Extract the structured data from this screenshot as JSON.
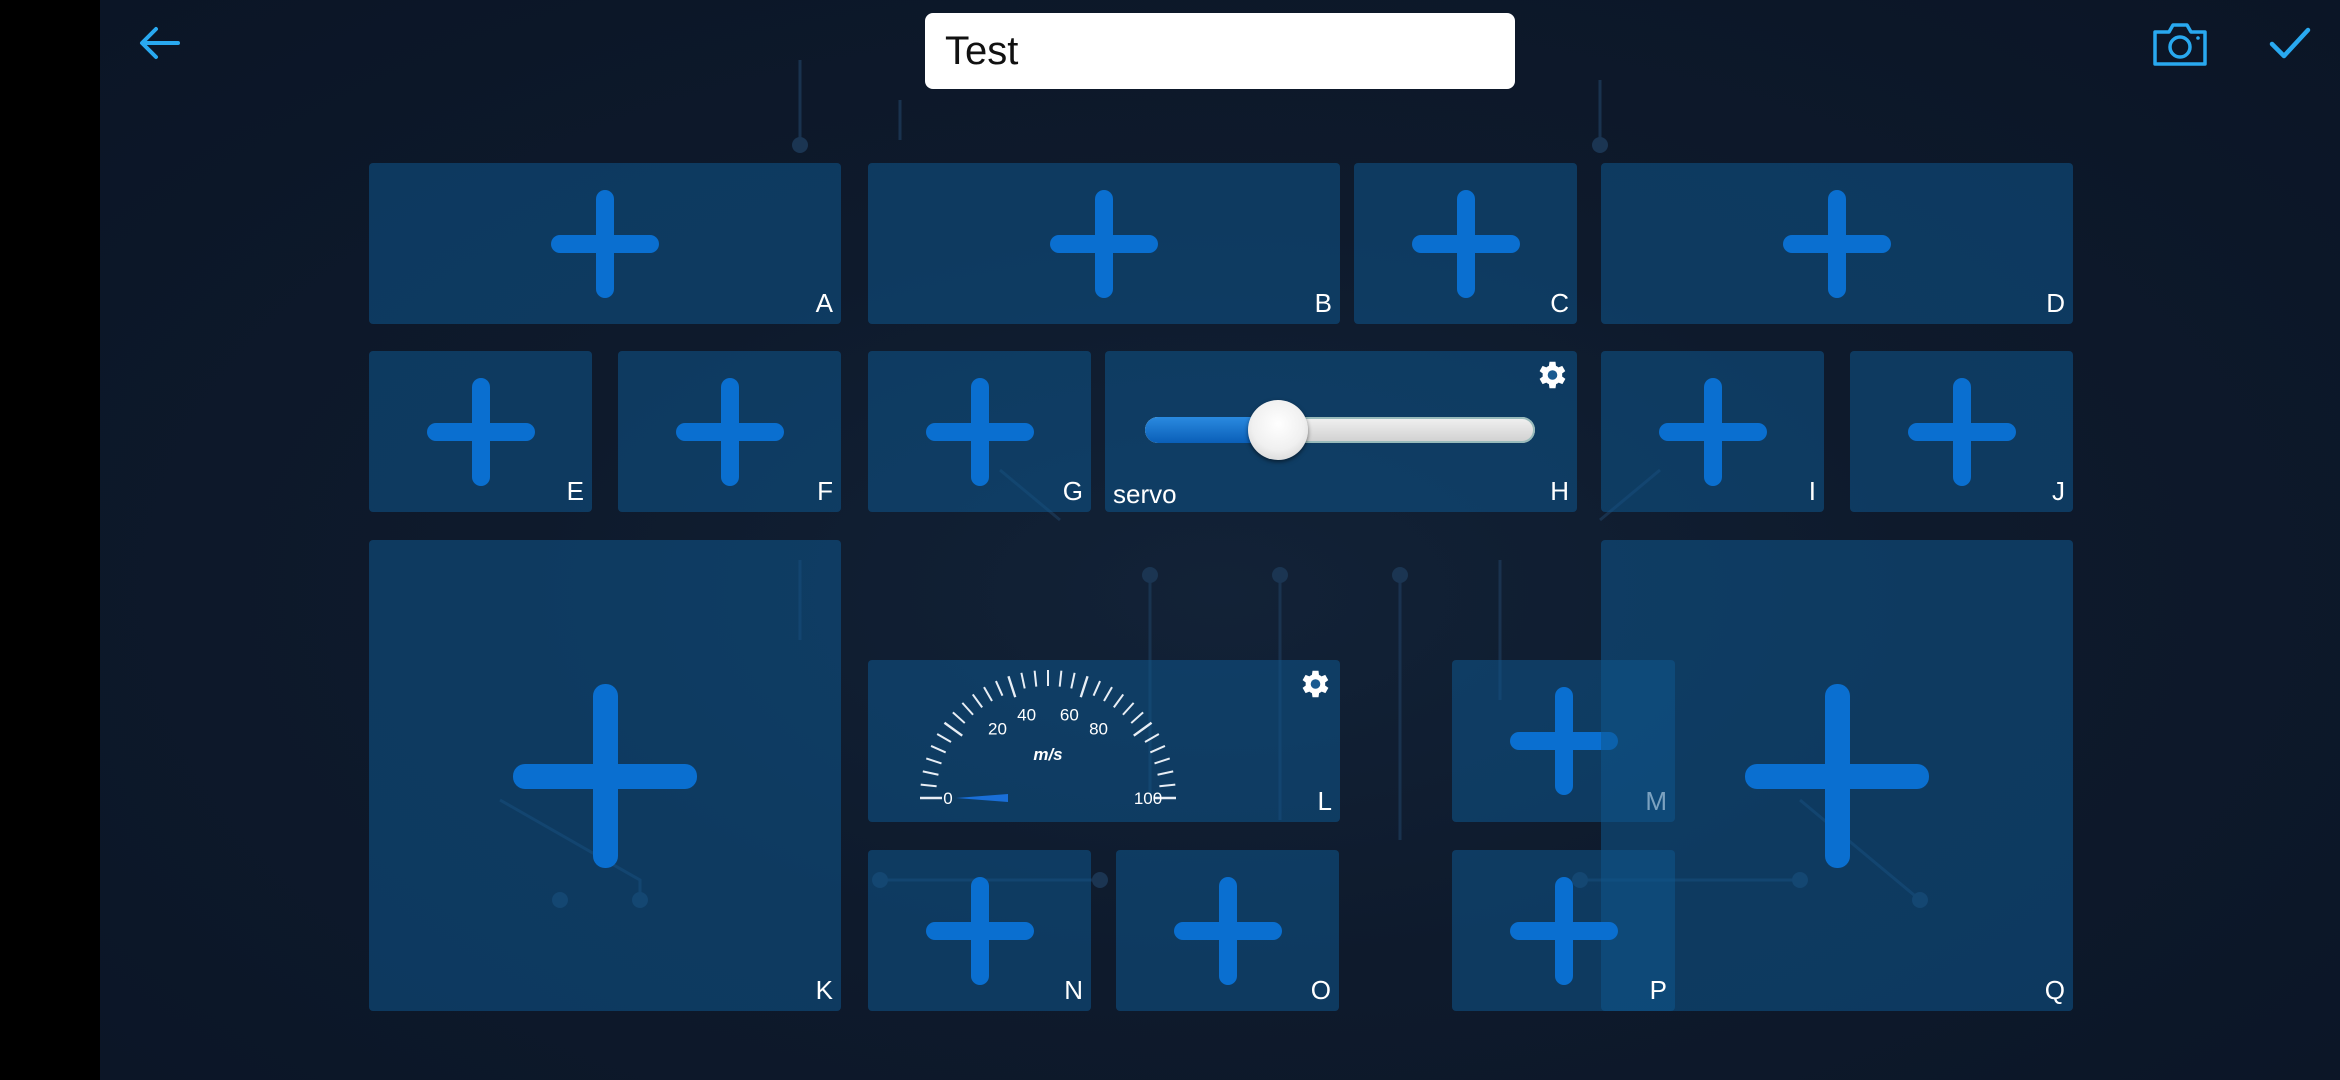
{
  "header": {
    "title_value": "Test",
    "back_icon": "arrow-left-icon",
    "camera_icon": "camera-icon",
    "confirm_icon": "checkmark-icon",
    "accent_color": "#29a9f0"
  },
  "tiles": [
    {
      "label": "A"
    },
    {
      "label": "B"
    },
    {
      "label": "C"
    },
    {
      "label": "D"
    },
    {
      "label": "E"
    },
    {
      "label": "F"
    },
    {
      "label": "G"
    },
    {
      "label": "H"
    },
    {
      "label": "I"
    },
    {
      "label": "J"
    },
    {
      "label": "K"
    },
    {
      "label": "L"
    },
    {
      "label": "M"
    },
    {
      "label": "N"
    },
    {
      "label": "O"
    },
    {
      "label": "P"
    },
    {
      "label": "Q"
    }
  ],
  "servo": {
    "name": "servo",
    "fraction": 0.34
  },
  "gauge": {
    "unit": "m/s",
    "ticks": [
      "0",
      "20",
      "40",
      "60",
      "80",
      "100"
    ],
    "min": 0,
    "max": 100,
    "value": 0
  },
  "colors": {
    "tile_plus": "#0a6fd0",
    "tile_bg": "#0f558c"
  }
}
